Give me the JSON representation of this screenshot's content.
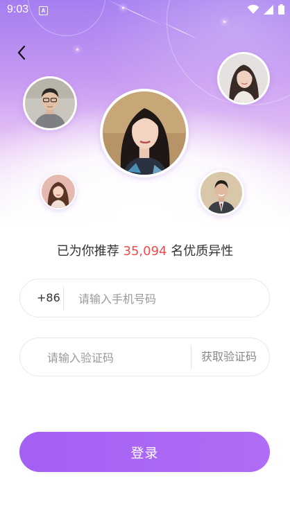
{
  "status_bar": {
    "time": "9:03",
    "notification_glyph": "A",
    "icons": [
      "wifi-icon",
      "signal-icon",
      "battery-icon"
    ]
  },
  "nav": {
    "back_icon": "chevron-left-icon"
  },
  "avatars": [
    {
      "name": "avatar-man-glasses",
      "icon": "person-photo"
    },
    {
      "name": "avatar-woman-top-right",
      "icon": "person-photo"
    },
    {
      "name": "avatar-woman-center",
      "icon": "person-photo"
    },
    {
      "name": "avatar-woman-small",
      "icon": "person-photo"
    },
    {
      "name": "avatar-man-suit",
      "icon": "person-photo"
    }
  ],
  "tagline": {
    "prefix": "已为你推荐",
    "count": "35,094",
    "suffix": "名优质异性"
  },
  "phone": {
    "prefix": "+86",
    "placeholder": "请输入手机号码",
    "value": ""
  },
  "code": {
    "placeholder": "请输入验证码",
    "value": "",
    "get_code_label": "获取验证码"
  },
  "login": {
    "label": "登录"
  },
  "colors": {
    "accent": "#a45ff3",
    "highlight_number": "#f04a4a",
    "hero_top": "#a47ef0"
  }
}
